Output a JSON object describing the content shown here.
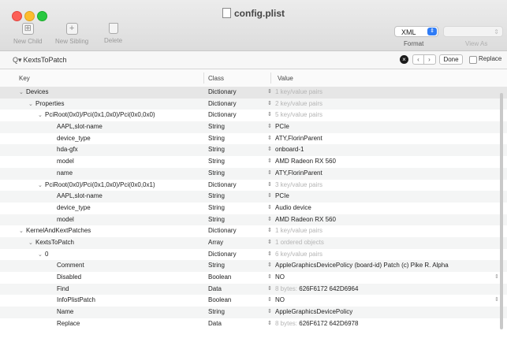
{
  "window": {
    "title": "config.plist"
  },
  "toolbar": {
    "new_child": "New Child",
    "new_sibling": "New Sibling",
    "delete": "Delete",
    "format_value": "XML",
    "format_label": "Format",
    "view_as_label": "View As"
  },
  "find": {
    "query": "KextsToPatch",
    "done": "Done",
    "replace": "Replace"
  },
  "columns": {
    "key": "Key",
    "class": "Class",
    "value": "Value"
  },
  "rows": [
    {
      "key": "Devices",
      "indent": 1,
      "disclosure": "down",
      "cls": "Dictionary",
      "value": "1 key/value pairs",
      "dim": true
    },
    {
      "key": "Properties",
      "indent": 2,
      "disclosure": "down",
      "cls": "Dictionary",
      "value": "2 key/value pairs",
      "dim": true
    },
    {
      "key": "PciRoot(0x0)/Pci(0x1,0x0)/Pci(0x0,0x0)",
      "indent": 3,
      "disclosure": "down",
      "cls": "Dictionary",
      "value": "5 key/value pairs",
      "dim": true
    },
    {
      "key": "AAPL,slot-name",
      "indent": 4,
      "cls": "String",
      "value": "PCIe"
    },
    {
      "key": "device_type",
      "indent": 4,
      "cls": "String",
      "value": "ATY,FlorinParent"
    },
    {
      "key": "hda-gfx",
      "indent": 4,
      "cls": "String",
      "value": "onboard-1"
    },
    {
      "key": "model",
      "indent": 4,
      "cls": "String",
      "value": "AMD Radeon RX 560"
    },
    {
      "key": "name",
      "indent": 4,
      "cls": "String",
      "value": "ATY,FlorinParent"
    },
    {
      "key": "PciRoot(0x0)/Pci(0x1,0x0)/Pci(0x0,0x1)",
      "indent": 3,
      "disclosure": "down",
      "cls": "Dictionary",
      "value": "3 key/value pairs",
      "dim": true
    },
    {
      "key": "AAPL,slot-name",
      "indent": 4,
      "cls": "String",
      "value": "PCIe"
    },
    {
      "key": "device_type",
      "indent": 4,
      "cls": "String",
      "value": "Audio device"
    },
    {
      "key": "model",
      "indent": 4,
      "cls": "String",
      "value": "AMD Radeon RX 560"
    },
    {
      "key": "KernelAndKextPatches",
      "indent": 1,
      "disclosure": "down",
      "cls": "Dictionary",
      "value": "1 key/value pairs",
      "dim": true
    },
    {
      "key": "KextsToPatch",
      "indent": 2,
      "disclosure": "down",
      "cls": "Array",
      "value": "1 ordered objects",
      "dim": true
    },
    {
      "key": "0",
      "indent": 3,
      "disclosure": "down",
      "cls": "Dictionary",
      "value": "6 key/value pairs",
      "dim": true
    },
    {
      "key": "Comment",
      "indent": 4,
      "cls": "String",
      "value": "AppleGraphicsDevicePolicy (board-id) Patch (c) Pike R. Alpha"
    },
    {
      "key": "Disabled",
      "indent": 4,
      "cls": "Boolean",
      "value": "NO",
      "popup": true
    },
    {
      "key": "Find",
      "indent": 4,
      "cls": "Data",
      "value_prefix": "8 bytes:",
      "value": "626F6172 642D6964"
    },
    {
      "key": "InfoPlistPatch",
      "indent": 4,
      "cls": "Boolean",
      "value": "NO",
      "popup": true
    },
    {
      "key": "Name",
      "indent": 4,
      "cls": "String",
      "value": "AppleGraphicsDevicePolicy"
    },
    {
      "key": "Replace",
      "indent": 4,
      "cls": "Data",
      "value_prefix": "8 bytes:",
      "value": "626F6172 642D6978"
    }
  ]
}
